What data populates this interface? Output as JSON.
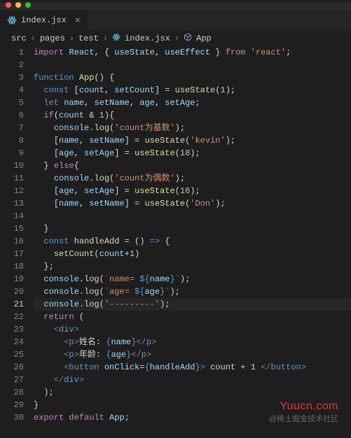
{
  "tab": {
    "filename": "index.jsx"
  },
  "breadcrumbs": {
    "parts": [
      "src",
      "pages",
      "test",
      "index.jsx",
      "App"
    ]
  },
  "code": {
    "lines": [
      {
        "n": 1,
        "html": "<span class='k-purple'>import</span> <span class='k-lightblue'>React</span><span class='k-punc'>, { </span><span class='k-lightblue'>useState</span><span class='k-punc'>, </span><span class='k-lightblue'>useEffect</span><span class='k-punc'> } </span><span class='k-purple'>from</span> <span class='k-str'>'react'</span><span class='k-punc'>;</span>"
      },
      {
        "n": 2,
        "html": ""
      },
      {
        "n": 3,
        "html": "<span class='k-blue'>function</span> <span class='k-fn'>App</span><span class='k-punc'>() {</span>"
      },
      {
        "n": 4,
        "html": "  <span class='k-blue'>const</span> <span class='k-punc'>[</span><span class='k-lightblue'>count</span><span class='k-punc'>, </span><span class='k-lightblue'>setCount</span><span class='k-punc'>] = </span><span class='k-fn'>useState</span><span class='k-punc'>(</span><span class='k-num'>1</span><span class='k-punc'>);</span>"
      },
      {
        "n": 5,
        "html": "  <span class='k-blue'>let</span> <span class='k-lightblue'>name</span><span class='k-punc'>, </span><span class='k-lightblue'>setName</span><span class='k-punc'>, </span><span class='k-lightblue'>age</span><span class='k-punc'>, </span><span class='k-lightblue'>setAge</span><span class='k-punc'>;</span>"
      },
      {
        "n": 6,
        "html": "  <span class='k-purple'>if</span><span class='k-punc'>(</span><span class='k-lightblue'>count</span> <span class='k-punc'>&amp;</span> <span class='k-num'>1</span><span class='k-punc'>){</span>"
      },
      {
        "n": 7,
        "html": "    <span class='k-lightblue'>console</span><span class='k-punc'>.</span><span class='k-fn'>log</span><span class='k-punc'>(</span><span class='k-str'>'count为基数'</span><span class='k-punc'>);</span>"
      },
      {
        "n": 8,
        "html": "    <span class='k-punc'>[</span><span class='k-lightblue'>name</span><span class='k-punc'>, </span><span class='k-lightblue'>setName</span><span class='k-punc'>] = </span><span class='k-fn'>useState</span><span class='k-punc'>(</span><span class='k-str'>'kevin'</span><span class='k-punc'>);</span>"
      },
      {
        "n": 9,
        "html": "    <span class='k-punc'>[</span><span class='k-lightblue'>age</span><span class='k-punc'>, </span><span class='k-lightblue'>setAge</span><span class='k-punc'>] = </span><span class='k-fn'>useState</span><span class='k-punc'>(</span><span class='k-num'>18</span><span class='k-punc'>);</span>"
      },
      {
        "n": 10,
        "html": "  <span class='k-punc'>}</span> <span class='k-purple'>else</span><span class='k-punc'>{</span>"
      },
      {
        "n": 11,
        "html": "    <span class='k-lightblue'>console</span><span class='k-punc'>.</span><span class='k-fn'>log</span><span class='k-punc'>(</span><span class='k-str'>'count为偶数'</span><span class='k-punc'>);</span>"
      },
      {
        "n": 12,
        "html": "    <span class='k-punc'>[</span><span class='k-lightblue'>age</span><span class='k-punc'>, </span><span class='k-lightblue'>setAge</span><span class='k-punc'>] = </span><span class='k-fn'>useState</span><span class='k-punc'>(</span><span class='k-num'>16</span><span class='k-punc'>);</span>"
      },
      {
        "n": 13,
        "html": "    <span class='k-punc'>[</span><span class='k-lightblue'>name</span><span class='k-punc'>, </span><span class='k-lightblue'>setName</span><span class='k-punc'>] = </span><span class='k-fn'>useState</span><span class='k-punc'>(</span><span class='k-str'>'Don'</span><span class='k-punc'>);</span>"
      },
      {
        "n": 14,
        "html": ""
      },
      {
        "n": 15,
        "html": "  <span class='k-punc'>}</span>"
      },
      {
        "n": 16,
        "html": "  <span class='k-blue'>const</span> <span class='k-fn'>handleAdd</span> <span class='k-punc'>= () </span><span class='k-blue'>=&gt;</span><span class='k-punc'> {</span>"
      },
      {
        "n": 17,
        "html": "    <span class='k-fn'>setCount</span><span class='k-punc'>(</span><span class='k-lightblue'>count</span><span class='k-punc'>+</span><span class='k-num'>1</span><span class='k-punc'>)</span>"
      },
      {
        "n": 18,
        "html": "  <span class='k-punc'>};</span>"
      },
      {
        "n": 19,
        "html": "  <span class='k-lightblue'>console</span><span class='k-punc'>.</span><span class='k-fn'>log</span><span class='k-punc'>(</span><span class='k-str'>`name= </span><span class='k-blue'>${</span><span class='k-lightblue'>name</span><span class='k-blue'>}</span><span class='k-str'>`</span><span class='k-punc'>);</span>"
      },
      {
        "n": 20,
        "html": "  <span class='k-lightblue'>console</span><span class='k-punc'>.</span><span class='k-fn'>log</span><span class='k-punc'>(</span><span class='k-str'>`age= </span><span class='k-blue'>${</span><span class='k-lightblue'>age</span><span class='k-blue'>}</span><span class='k-str'>`</span><span class='k-punc'>);</span>"
      },
      {
        "n": 21,
        "active": true,
        "html": "  <span class='k-lightblue'>console</span><span class='k-punc'>.</span><span class='k-fn'>log</span><span class='k-punc'>(</span><span class='k-str'>'---------'</span><span class='k-punc'>);</span>"
      },
      {
        "n": 22,
        "html": "  <span class='k-purple'>return</span> <span class='k-punc'>(</span>"
      },
      {
        "n": 23,
        "html": "    <span class='k-grey'>&lt;</span><span class='k-blue'>div</span><span class='k-grey'>&gt;</span>"
      },
      {
        "n": 24,
        "html": "      <span class='k-grey'>&lt;</span><span class='k-blue'>p</span><span class='k-grey'>&gt;</span><span class='k-punc'>姓名: </span><span class='k-blue'>{</span><span class='k-lightblue'>name</span><span class='k-blue'>}</span><span class='k-grey'>&lt;/</span><span class='k-blue'>p</span><span class='k-grey'>&gt;</span>"
      },
      {
        "n": 25,
        "html": "      <span class='k-grey'>&lt;</span><span class='k-blue'>p</span><span class='k-grey'>&gt;</span><span class='k-punc'>年龄: </span><span class='k-blue'>{</span><span class='k-lightblue'>age</span><span class='k-blue'>}</span><span class='k-grey'>&lt;/</span><span class='k-blue'>p</span><span class='k-grey'>&gt;</span>"
      },
      {
        "n": 26,
        "html": "      <span class='k-grey'>&lt;</span><span class='k-blue'>button</span> <span class='k-lightblue'>onClick</span><span class='k-punc'>=</span><span class='k-blue'>{</span><span class='k-lightblue'>handleAdd</span><span class='k-blue'>}</span><span class='k-grey'>&gt;</span><span class='k-punc'> count + 1 </span><span class='k-grey'>&lt;/</span><span class='k-blue'>button</span><span class='k-grey'>&gt;</span>"
      },
      {
        "n": 27,
        "html": "    <span class='k-grey'>&lt;/</span><span class='k-blue'>div</span><span class='k-grey'>&gt;</span>"
      },
      {
        "n": 28,
        "html": "  <span class='k-punc'>);</span>"
      },
      {
        "n": 29,
        "html": "<span class='k-punc'>}</span>"
      },
      {
        "n": 30,
        "html": "<span class='k-purple'>export</span> <span class='k-purple'>default</span> <span class='k-lightblue'>App</span><span class='k-punc'>;</span>"
      }
    ]
  },
  "watermark": "Yuucn.com",
  "footermark": "@稀土掘金技术社区"
}
